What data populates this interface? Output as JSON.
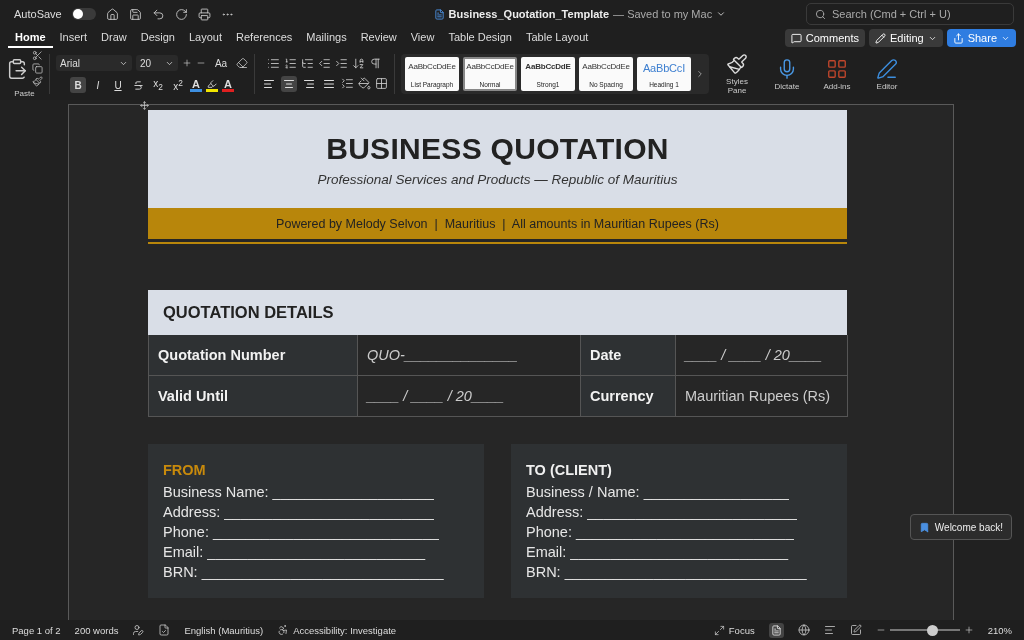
{
  "title_bar": {
    "autosave_label": "AutoSave",
    "autosave_on": false,
    "doc_title": "Business_Quotation_Template",
    "save_status": "— Saved to my Mac",
    "search_placeholder": "Search (Cmd + Ctrl + U)"
  },
  "tabs": [
    {
      "label": "Home",
      "selected": true
    },
    {
      "label": "Insert",
      "selected": false
    },
    {
      "label": "Draw",
      "selected": false
    },
    {
      "label": "Design",
      "selected": false
    },
    {
      "label": "Layout",
      "selected": false
    },
    {
      "label": "References",
      "selected": false
    },
    {
      "label": "Mailings",
      "selected": false
    },
    {
      "label": "Review",
      "selected": false
    },
    {
      "label": "View",
      "selected": false
    },
    {
      "label": "Table Design",
      "selected": false
    },
    {
      "label": "Table Layout",
      "selected": false
    }
  ],
  "actions": [
    {
      "kind": "comments",
      "label": "Comments"
    },
    {
      "kind": "editing",
      "label": "Editing"
    },
    {
      "kind": "share",
      "label": "Share"
    }
  ],
  "ribbon": {
    "paste_label": "Paste",
    "font_name": "Arial",
    "font_size": "20",
    "case_label": "Aa",
    "format_buttons": [
      {
        "kind": "bold",
        "label": "B",
        "on": true
      },
      {
        "kind": "italic",
        "label": "I",
        "on": false
      },
      {
        "kind": "underline",
        "label": "U",
        "on": false
      },
      {
        "kind": "strike",
        "on": false
      },
      {
        "kind": "sub",
        "label": "x$_{2}$",
        "on": false
      },
      {
        "kind": "sup",
        "label": "x$^{2}$",
        "on": false
      }
    ],
    "color_buttons": [
      {
        "kind": "effects",
        "label": "A",
        "color": "#3d8fe0"
      },
      {
        "kind": "highlight",
        "color": "#f2e600"
      },
      {
        "kind": "font_color",
        "label": "A",
        "color": "#e02020"
      }
    ],
    "align_buttons": [
      {
        "kind": "left",
        "selected": false
      },
      {
        "kind": "center",
        "selected": true
      },
      {
        "kind": "right",
        "selected": false
      },
      {
        "kind": "justify",
        "selected": false
      }
    ],
    "styles": [
      {
        "preview": "AaBbCcDdEe",
        "name": "List Paragraph",
        "kind": "plain",
        "selected": false
      },
      {
        "preview": "AaBbCcDdEe",
        "name": "Normal",
        "kind": "plain",
        "selected": true
      },
      {
        "preview": "AaBbCcDdE",
        "name": "Strong1",
        "kind": "strong",
        "selected": false
      },
      {
        "preview": "AaBbCcDdEe",
        "name": "No Spacing",
        "kind": "plain",
        "selected": false
      },
      {
        "preview": "AaBbCcI",
        "name": "Heading 1",
        "kind": "heading",
        "selected": false
      }
    ],
    "tools": [
      {
        "kind": "styles_pane",
        "label": "Styles Pane"
      },
      {
        "kind": "dictate",
        "label": "Dictate"
      },
      {
        "kind": "addins",
        "label": "Add-ins"
      },
      {
        "kind": "editor",
        "label": "Editor"
      }
    ]
  },
  "document": {
    "title": "BUSINESS QUOTATION",
    "subtitle": "Professional Services and Products — Republic of Mauritius",
    "banner": "Powered by Melody Selvon  |  Mauritius  |  All amounts in Mauritian Rupees (Rs)",
    "details_title": "QUOTATION DETAILS",
    "details_rows": [
      {
        "label": "Quotation Number",
        "value": "QUO-______________",
        "label_2": "Date",
        "value_2": "____ / ____ / 20____",
        "italic": true,
        "italic_2": true
      },
      {
        "label": "Valid Until",
        "value": "____ / ____ / 20____",
        "label_2": "Currency",
        "value_2": "Mauritian Rupees (Rs)",
        "italic": true,
        "italic_2": false
      }
    ],
    "parties": [
      {
        "title": "FROM",
        "accent": true,
        "lines": [
          "Business Name: ____________________",
          "Address: __________________________",
          "Phone: ____________________________",
          "Email: ___________________________",
          "BRN: ______________________________"
        ]
      },
      {
        "title": "TO (CLIENT)",
        "accent": false,
        "lines": [
          "Business / Name: __________________",
          "Address: __________________________",
          "Phone: ___________________________",
          "Email: ___________________________",
          "BRN: ______________________________"
        ]
      }
    ]
  },
  "toast": "Welcome back!",
  "status_bar": {
    "page": "Page 1 of 2",
    "words": "200 words",
    "language": "English (Mauritius)",
    "accessibility": "Accessibility: Investigate",
    "focus": "Focus",
    "level": 0.6,
    "zoom": "210%"
  }
}
